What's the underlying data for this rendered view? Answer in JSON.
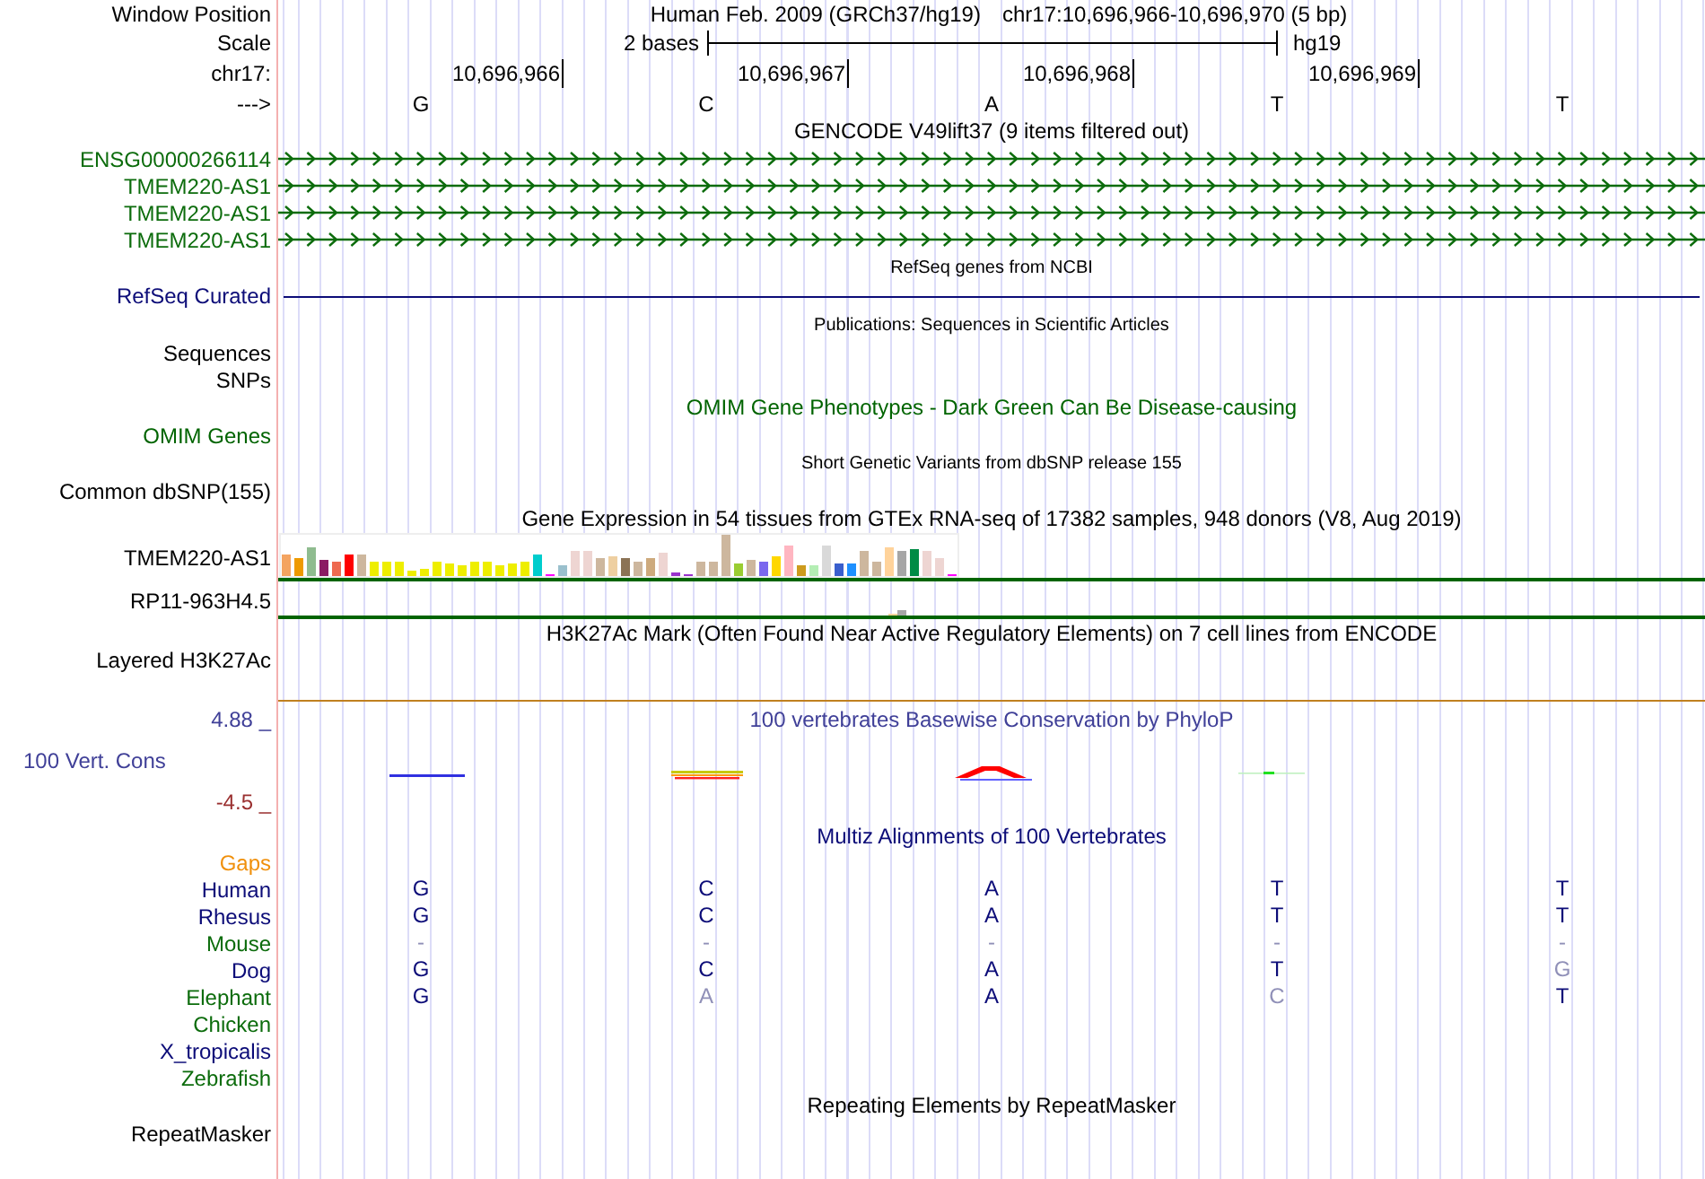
{
  "position": {
    "label": "Window Position",
    "assembly_text": "Human Feb. 2009 (GRCh37/hg19)",
    "range_text": "chr17:10,696,966-10,696,970 (5 bp)"
  },
  "scale": {
    "label": "Scale",
    "span_text": "2 bases",
    "assembly": "hg19"
  },
  "coordinates": {
    "label": "chr17:",
    "ticks": [
      "10,696,966",
      "10,696,967",
      "10,696,968",
      "10,696,969"
    ]
  },
  "bases": {
    "label": "--->",
    "letters": [
      "G",
      "C",
      "A",
      "T",
      "T"
    ]
  },
  "tracks": [
    {
      "kind": "title",
      "text": "GENCODE V49lift37 (9 items filtered out)"
    },
    {
      "kind": "gene",
      "label": "ENSG00000266114",
      "color": "#0c6c0c"
    },
    {
      "kind": "gene",
      "label": "TMEM220-AS1",
      "color": "#0c6c0c"
    },
    {
      "kind": "gene",
      "label": "TMEM220-AS1",
      "color": "#0c6c0c"
    },
    {
      "kind": "gene",
      "label": "TMEM220-AS1",
      "color": "#0c6c0c"
    },
    {
      "kind": "subtitle",
      "text": "RefSeq genes from NCBI"
    },
    {
      "kind": "line",
      "label": "RefSeq Curated",
      "color": "#0c0c78"
    },
    {
      "kind": "subtitle",
      "text": "Publications: Sequences in Scientific Articles"
    },
    {
      "kind": "label",
      "label": "Sequences"
    },
    {
      "kind": "label",
      "label": "SNPs"
    },
    {
      "kind": "title",
      "text": "OMIM Gene Phenotypes - Dark Green Can Be Disease-causing",
      "color": "#006400"
    },
    {
      "kind": "label",
      "label": "OMIM Genes",
      "color": "#006400"
    },
    {
      "kind": "subtitle",
      "text": "Short Genetic Variants from dbSNP release 155"
    },
    {
      "kind": "label",
      "label": "Common dbSNP(155)"
    },
    {
      "kind": "title",
      "text": "Gene Expression in 54 tissues from GTEx RNA-seq of 17382 samples, 948 donors (V8, Aug 2019)"
    },
    {
      "kind": "expression",
      "label": "TMEM220-AS1"
    },
    {
      "kind": "trace",
      "label": "RP11-963H4.5"
    },
    {
      "kind": "title",
      "text": "H3K27Ac Mark (Often Found Near Active Regulatory Elements) on 7 cell lines from ENCODE"
    },
    {
      "kind": "layered",
      "label": "Layered H3K27Ac"
    },
    {
      "kind": "conservation",
      "title": "100 vertebrates Basewise Conservation by PhyloP",
      "label": "100 Vert. Cons",
      "max": "4.88 _",
      "min": "-4.5 _"
    },
    {
      "kind": "title",
      "text": "Multiz Alignments of 100 Vertebrates",
      "color": "#0c0c78"
    },
    {
      "kind": "gaps",
      "label": "Gaps",
      "color": "#f0900c"
    },
    {
      "kind": "alignment",
      "label": "Human",
      "color": "#0c0c78",
      "bases": [
        {
          "base": "G",
          "differs": false
        },
        {
          "base": "C",
          "differs": false
        },
        {
          "base": "A",
          "differs": false
        },
        {
          "base": "T",
          "differs": false
        },
        {
          "base": "T",
          "differs": false
        }
      ]
    },
    {
      "kind": "alignment",
      "label": "Rhesus",
      "color": "#0c0c78",
      "bases": [
        {
          "base": "G",
          "differs": false
        },
        {
          "base": "C",
          "differs": false
        },
        {
          "base": "A",
          "differs": false
        },
        {
          "base": "T",
          "differs": false
        },
        {
          "base": "T",
          "differs": false
        }
      ]
    },
    {
      "kind": "alignment",
      "label": "Mouse",
      "color": "#0c6c0c",
      "bases": [
        {
          "base": "-",
          "differs": true
        },
        {
          "base": "-",
          "differs": true
        },
        {
          "base": "-",
          "differs": true
        },
        {
          "base": "-",
          "differs": true
        },
        {
          "base": "-",
          "differs": true
        }
      ]
    },
    {
      "kind": "alignment",
      "label": "Dog",
      "color": "#0c0c78",
      "bases": [
        {
          "base": "G",
          "differs": false
        },
        {
          "base": "C",
          "differs": false
        },
        {
          "base": "A",
          "differs": false
        },
        {
          "base": "T",
          "differs": false
        },
        {
          "base": "G",
          "differs": true
        }
      ]
    },
    {
      "kind": "alignment",
      "label": "Elephant",
      "color": "#0c6c0c",
      "bases": [
        {
          "base": "G",
          "differs": false
        },
        {
          "base": "A",
          "differs": true
        },
        {
          "base": "A",
          "differs": false
        },
        {
          "base": "C",
          "differs": true
        },
        {
          "base": "T",
          "differs": false
        }
      ]
    },
    {
      "kind": "alignment",
      "label": "Chicken",
      "color": "#0c6c0c"
    },
    {
      "kind": "alignment",
      "label": "X_tropicalis",
      "color": "#0c0c78"
    },
    {
      "kind": "alignment",
      "label": "Zebrafish",
      "color": "#0c6c0c"
    },
    {
      "kind": "title",
      "text": "Repeating Elements by RepeatMasker"
    },
    {
      "kind": "label",
      "label": "RepeatMasker"
    }
  ]
}
